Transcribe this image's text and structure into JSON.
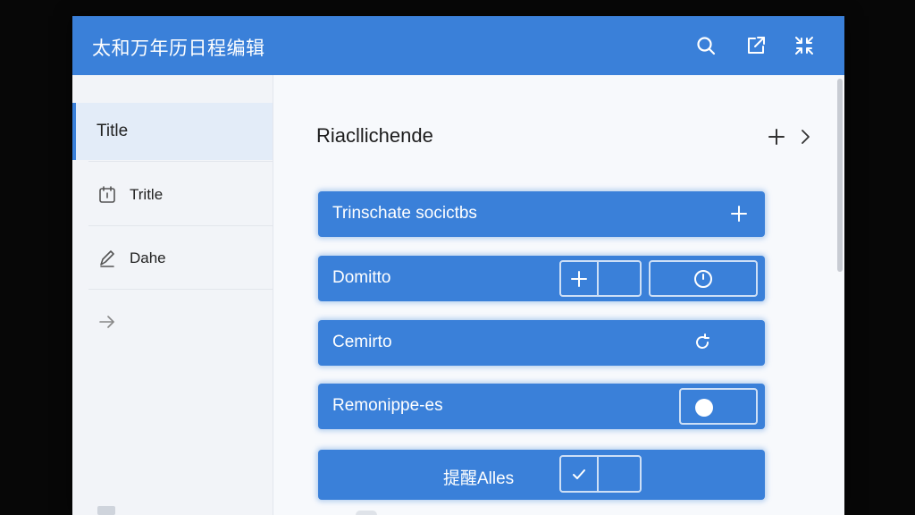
{
  "window": {
    "title": "太和万年历日程编辑",
    "controls": [
      "search-icon",
      "export-icon",
      "collapse-icon"
    ]
  },
  "sidebar": {
    "items": [
      {
        "label": "Title",
        "icon": "",
        "active": true
      },
      {
        "label": "Tritle",
        "icon": "calendar-icon",
        "active": false
      },
      {
        "label": "Dahe",
        "icon": "edit-icon",
        "active": false
      },
      {
        "label": "",
        "icon": "arrow-right-icon",
        "active": false
      }
    ]
  },
  "main": {
    "section_title": "Riacl​lichende",
    "header_actions": [
      "plus-icon",
      "chevron-right-icon"
    ],
    "rows": [
      {
        "label": "Trinschate socictbs",
        "icon": "plus-icon"
      },
      {
        "label": "Domitto",
        "icon": "plus-icon",
        "secondary_icon": "clock-icon"
      },
      {
        "label": "Cemirto",
        "icon": "refresh-icon"
      },
      {
        "label": "Remonippe-es",
        "icon": "toggle-dot-icon"
      },
      {
        "label": "提醒Alles",
        "icon": "checkbox-checked-icon",
        "checked": true
      }
    ]
  },
  "colors": {
    "accent": "#3a80d9",
    "background": "#f5f7fb",
    "sidebar_active": "#e3ecf8"
  }
}
